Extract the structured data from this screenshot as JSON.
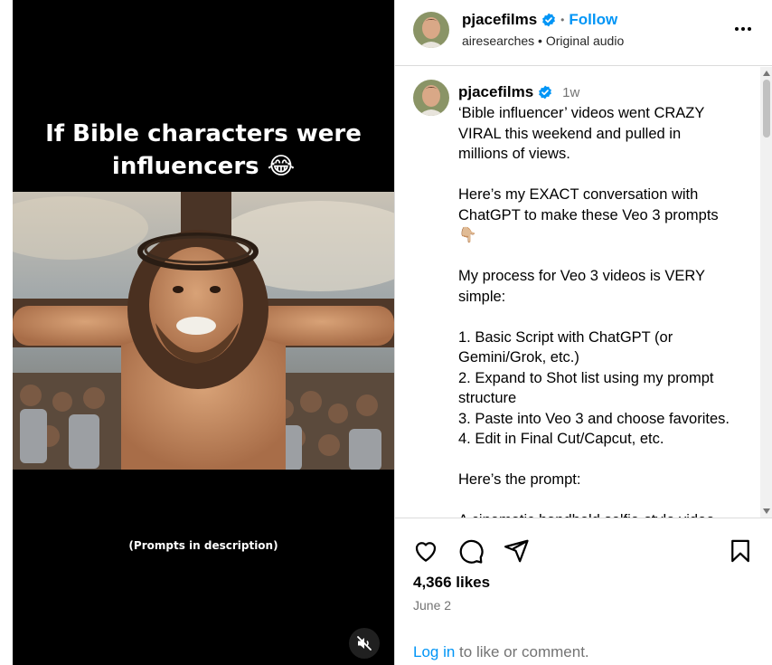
{
  "video": {
    "title_line1": "If Bible characters were",
    "title_line2": "influencers",
    "title_emoji": "😂",
    "caption": "(Prompts in description)",
    "mute_icon": "speaker-muted-icon"
  },
  "header": {
    "username": "pjacefilms",
    "verified_icon": "verified-badge-icon",
    "separator": "•",
    "follow_label": "Follow",
    "sub_user": "airesearches",
    "sub_separator": "•",
    "sub_audio": "Original audio",
    "more_icon": "more-options-icon"
  },
  "caption": {
    "username": "pjacefilms",
    "time": "1w",
    "lines": [
      "‘Bible influencer’ videos went CRAZY",
      "VIRAL this weekend and pulled in",
      "millions of views.",
      "",
      "Here’s my EXACT conversation with",
      "ChatGPT to make these Veo 3 prompts",
      "👇🏼",
      "",
      "My process for Veo 3 videos is VERY",
      "simple:",
      "",
      "1. Basic Script with ChatGPT (or",
      "Gemini/Grok, etc.)",
      "2. Expand to Shot list using my prompt",
      "structure",
      "3. Paste into Veo 3 and choose favorites.",
      "4. Edit in Final Cut/Capcut, etc.",
      "",
      "Here’s the prompt:",
      "",
      "A cinematic handheld selfie-style video"
    ]
  },
  "actions": {
    "like_icon": "heart-icon",
    "comment_icon": "comment-icon",
    "share_icon": "share-icon",
    "save_icon": "bookmark-icon",
    "likes": "4,366 likes",
    "date": "June 2",
    "login_link": "Log in",
    "login_rest": " to like or comment."
  },
  "colors": {
    "accent": "#0095f6",
    "verified": "#0095f6",
    "muted_text": "#737373",
    "divider": "#dbdbdb"
  }
}
